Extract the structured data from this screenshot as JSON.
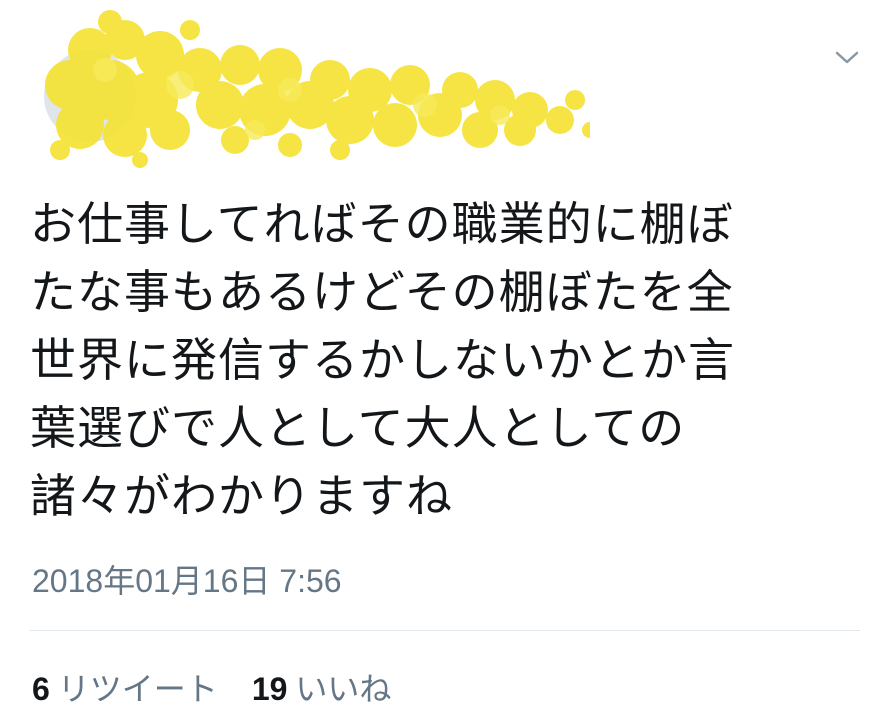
{
  "tweet": {
    "text_lines": [
      "お仕事してればその職業的に棚ぼ",
      "たな事もあるけどその棚ぼたを全",
      "世界に発信するかしないかとか言",
      "葉選びで人として大人としての",
      "諸々がわかりますね"
    ],
    "timestamp": "2018年01月16日 7:56",
    "retweets": {
      "count": "6",
      "label": "リツイート"
    },
    "likes": {
      "count": "19",
      "label": "いいね"
    }
  },
  "icons": {
    "menu": "chevron-down-icon"
  },
  "colors": {
    "text": "#14171a",
    "secondary": "#657786",
    "divider": "#e1e8ed",
    "redaction": "#f5e33a"
  }
}
